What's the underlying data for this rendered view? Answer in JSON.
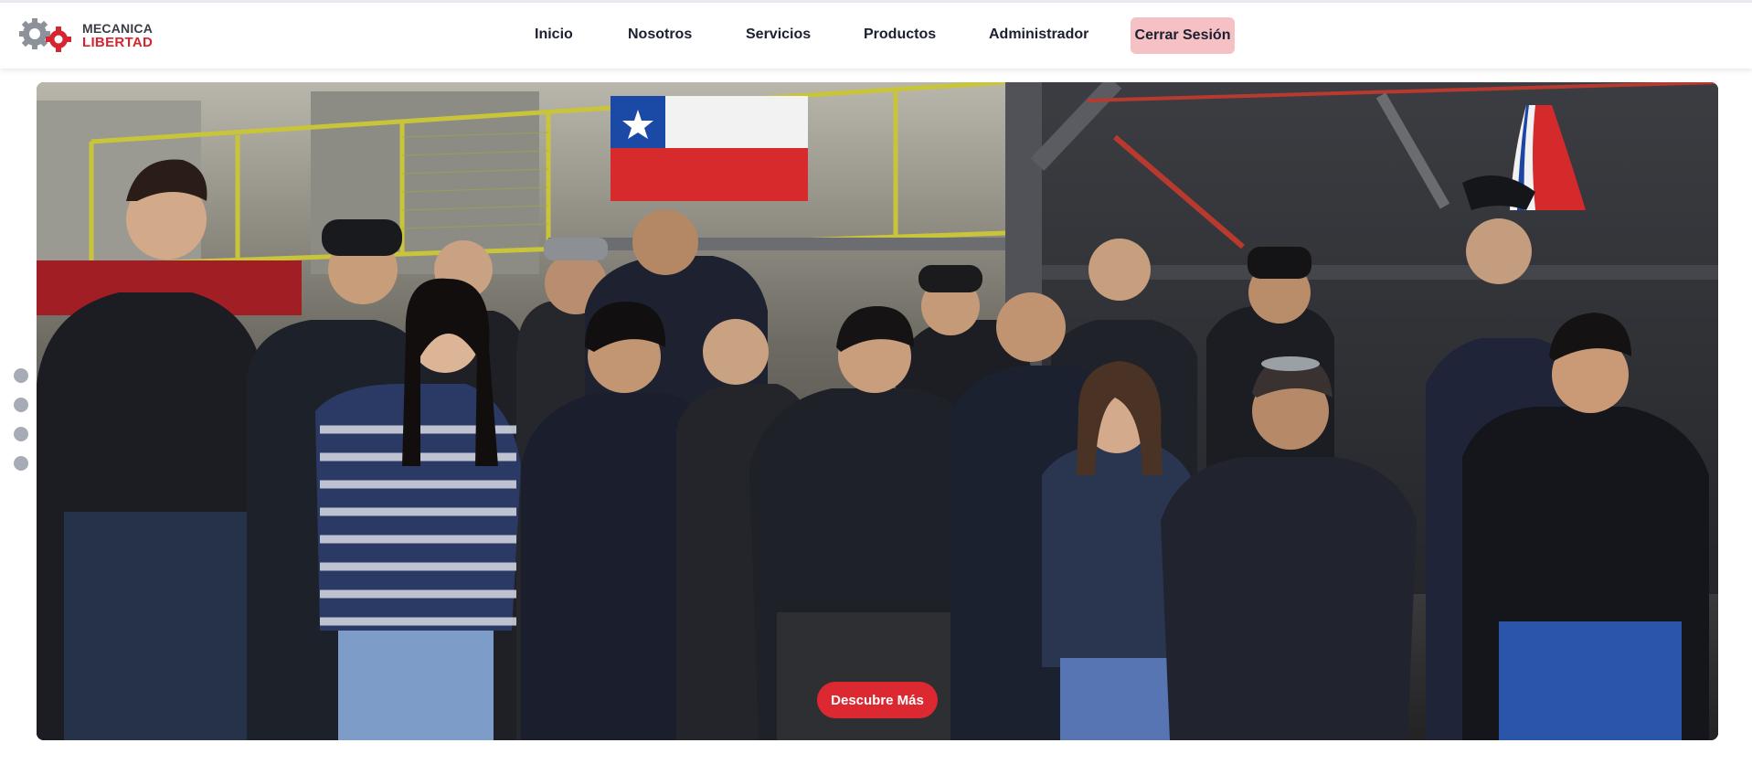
{
  "brand": {
    "line1": "MECANICA",
    "line2": "LIBERTAD",
    "logo_icon": "gears-logo-icon"
  },
  "nav": {
    "items": [
      {
        "label": "Inicio"
      },
      {
        "label": "Nosotros"
      },
      {
        "label": "Servicios"
      },
      {
        "label": "Productos"
      },
      {
        "label": "Administrador"
      }
    ],
    "logout_label": "Cerrar Sesión"
  },
  "hero": {
    "cta_label": "Descubre Más",
    "slide_count": 4
  },
  "colors": {
    "accent": "#dc2831",
    "logout_bg": "#f6c1c4",
    "nav_text": "#1b2030",
    "dot": "#a7abb5"
  }
}
